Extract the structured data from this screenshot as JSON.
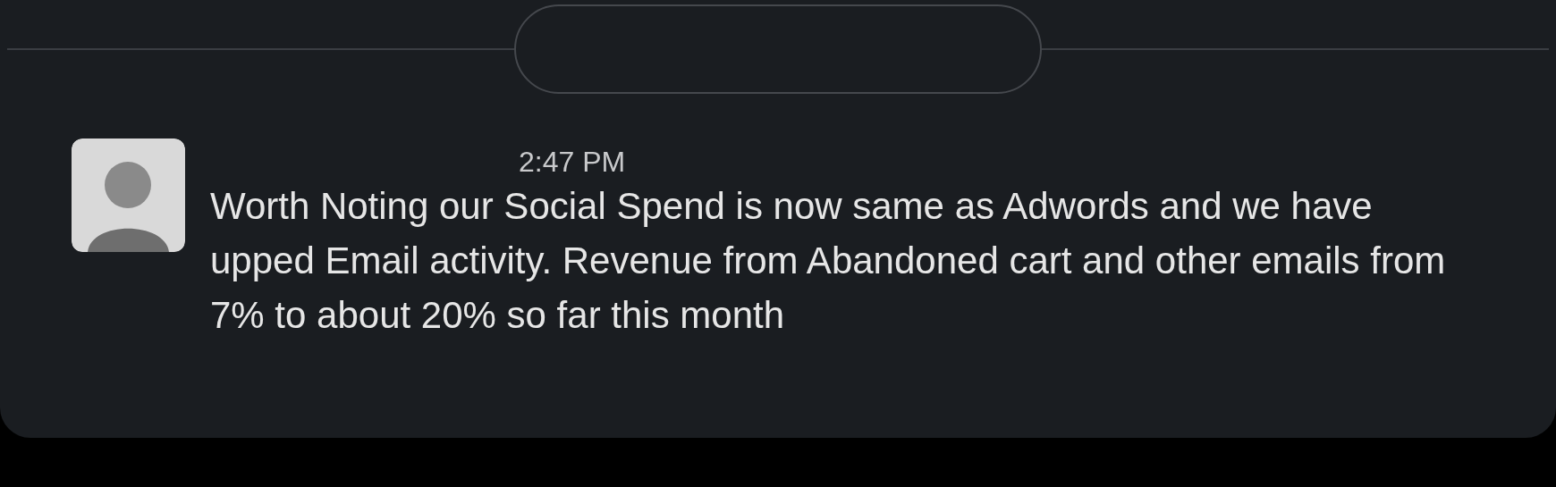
{
  "message": {
    "time": "2:47 PM",
    "text": "Worth Noting our Social Spend is now same as Adwords and we have upped Email activity. Revenue from Abandoned cart and other emails from 7% to about 20% so far this month"
  }
}
